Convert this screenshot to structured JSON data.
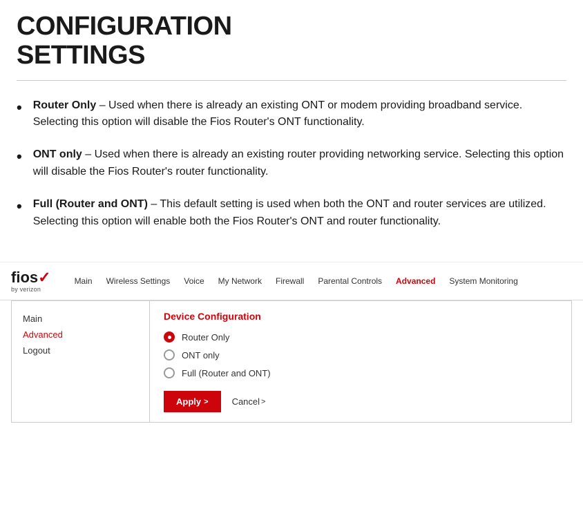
{
  "header": {
    "title_line1": "CONFIGURATION",
    "title_line2": "SETTINGS"
  },
  "bullets": [
    {
      "term": "Router Only",
      "description": " – Used when there is already an existing ONT or modem providing broadband service. Selecting this option will disable the Fios Router's ONT functionality."
    },
    {
      "term": "ONT only",
      "description": " – Used when there is already an existing router providing networking service. Selecting this option will disable the Fios Router's router functionality."
    },
    {
      "term": "Full (Router and ONT)",
      "description": " – This default setting is used when both the ONT and router services are utilized. Selecting this option will enable both the Fios Router's ONT and router functionality."
    }
  ],
  "logo": {
    "brand": "fios",
    "checkmark": "✓",
    "sub": "by verizon"
  },
  "nav": {
    "links": [
      {
        "label": "Main",
        "active": false
      },
      {
        "label": "Wireless Settings",
        "active": false
      },
      {
        "label": "Voice",
        "active": false
      },
      {
        "label": "My Network",
        "active": false
      },
      {
        "label": "Firewall",
        "active": false
      },
      {
        "label": "Parental Controls",
        "active": false
      },
      {
        "label": "Advanced",
        "active": true
      },
      {
        "label": "System Monitoring",
        "active": false
      }
    ]
  },
  "sidebar": {
    "items": [
      {
        "label": "Main",
        "active": false
      },
      {
        "label": "Advanced",
        "active": true
      },
      {
        "label": "Logout",
        "active": false
      }
    ]
  },
  "panel": {
    "section_title": "Device Configuration",
    "radio_options": [
      {
        "label": "Router Only",
        "selected": true
      },
      {
        "label": "ONT only",
        "selected": false
      },
      {
        "label": "Full (Router and ONT)",
        "selected": false
      }
    ],
    "apply_label": "Apply",
    "apply_chevron": ">",
    "cancel_label": "Cancel",
    "cancel_chevron": ">"
  }
}
